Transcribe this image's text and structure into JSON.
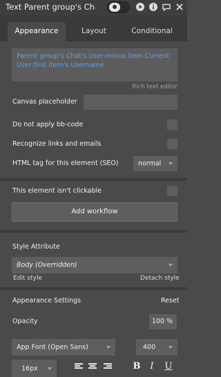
{
  "header": {
    "title": "Text Parent group's Chat",
    "icons": [
      "toggle",
      "play-icon",
      "info-icon",
      "comment-icon",
      "close-icon"
    ]
  },
  "tabs": [
    {
      "label": "Appearance",
      "active": true
    },
    {
      "label": "Layout",
      "active": false
    },
    {
      "label": "Conditional",
      "active": false
    }
  ],
  "editor": {
    "text": "Parent group's Chat's User:minus item Current User:first item's Username",
    "label": "Rich text editor"
  },
  "props": {
    "canvas_placeholder": "Canvas placeholder",
    "no_bbcode": "Do not apply bb-code",
    "recognize_links": "Recognize links and emails",
    "html_tag_label": "HTML tag for this element (SEO)",
    "html_tag_value": "normal",
    "not_clickable": "This element isn't clickable",
    "add_workflow": "Add workflow"
  },
  "style": {
    "label": "Style Attribute",
    "value": "Body (Overridden)",
    "edit": "Edit style",
    "detach": "Detach style"
  },
  "appearance": {
    "label": "Appearance Settings",
    "reset": "Reset",
    "opacity_label": "Opacity",
    "opacity_value": "100 %",
    "font": "App Font (Open Sans)",
    "weight": "400",
    "size": "16px",
    "bold": "B",
    "italic": "I",
    "underline": "U"
  },
  "colors": {
    "panel": "#4a4a4a",
    "dark": "#3a3a3a",
    "field": "#5e5e5e",
    "link_text": "#5fa0ea"
  }
}
